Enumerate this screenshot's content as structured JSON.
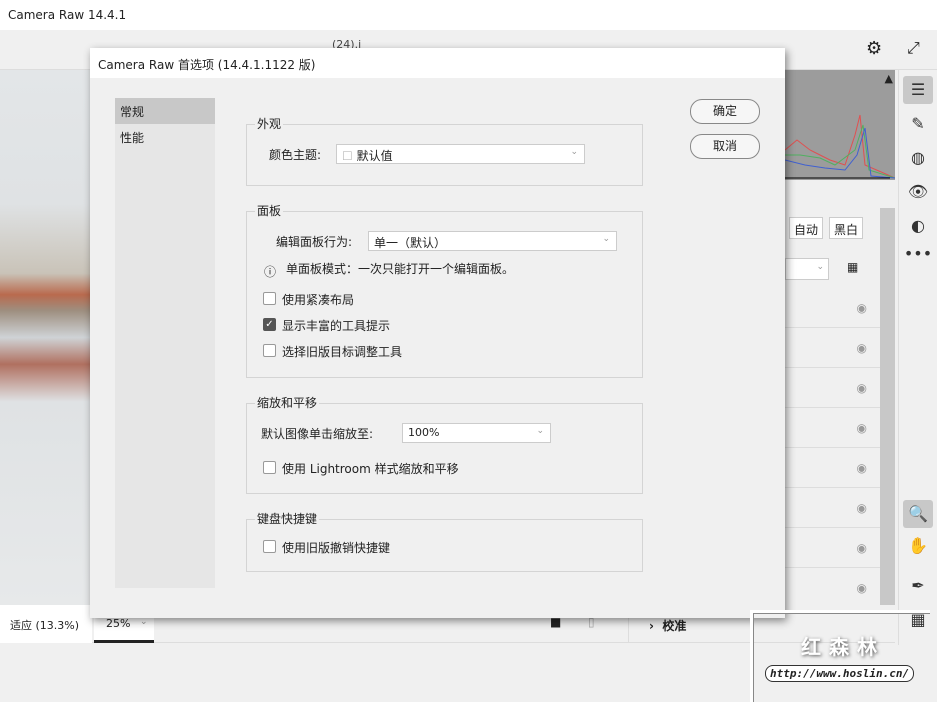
{
  "app": {
    "title": "Camera Raw 14.4.1",
    "filename": "(24).j"
  },
  "right_panel": {
    "auto": "自动",
    "bw": "黑白"
  },
  "bottom": {
    "fit": "适应 (13.3%)",
    "zoom": "25%",
    "calibrate": "校准"
  },
  "dialog": {
    "title": "Camera Raw 首选项 (14.4.1.1122 版)",
    "nav": [
      "常规",
      "性能"
    ],
    "ok": "确定",
    "cancel": "取消",
    "appearance": {
      "heading": "外观",
      "theme_label": "颜色主题:",
      "theme_value": "默认值"
    },
    "panels": {
      "heading": "面板",
      "behavior_label": "编辑面板行为:",
      "behavior_value": "单一（默认）",
      "info": "单面板模式：一次只能打开一个编辑面板。",
      "options": [
        {
          "label": "使用紧凑布局",
          "checked": false
        },
        {
          "label": "显示丰富的工具提示",
          "checked": true
        },
        {
          "label": "选择旧版目标调整工具",
          "checked": false
        }
      ]
    },
    "zoom": {
      "heading": "缩放和平移",
      "default_label": "默认图像单击缩放至:",
      "default_value": "100%",
      "lightroom": "使用 Lightroom 样式缩放和平移",
      "lightroom_checked": false
    },
    "shortcuts": {
      "heading": "键盘快捷键",
      "legacy": "使用旧版撤销快捷键",
      "legacy_checked": false
    }
  },
  "watermark": {
    "name": "红森林",
    "url": "http://www.hoslin.cn/"
  }
}
